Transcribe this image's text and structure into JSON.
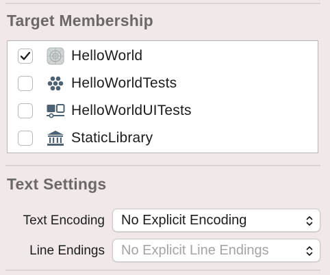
{
  "target_membership": {
    "header": "Target Membership",
    "targets": [
      {
        "label": "HelloWorld",
        "checked": true,
        "icon": "app-icon"
      },
      {
        "label": "HelloWorldTests",
        "checked": false,
        "icon": "unit-test-icon"
      },
      {
        "label": "HelloWorldUITests",
        "checked": false,
        "icon": "ui-test-icon"
      },
      {
        "label": "StaticLibrary",
        "checked": false,
        "icon": "library-icon"
      }
    ]
  },
  "text_settings": {
    "header": "Text Settings",
    "text_encoding": {
      "label": "Text Encoding",
      "value": "No Explicit Encoding",
      "enabled": true
    },
    "line_endings": {
      "label": "Line Endings",
      "value": "No Explicit Line Endings",
      "enabled": false
    }
  }
}
